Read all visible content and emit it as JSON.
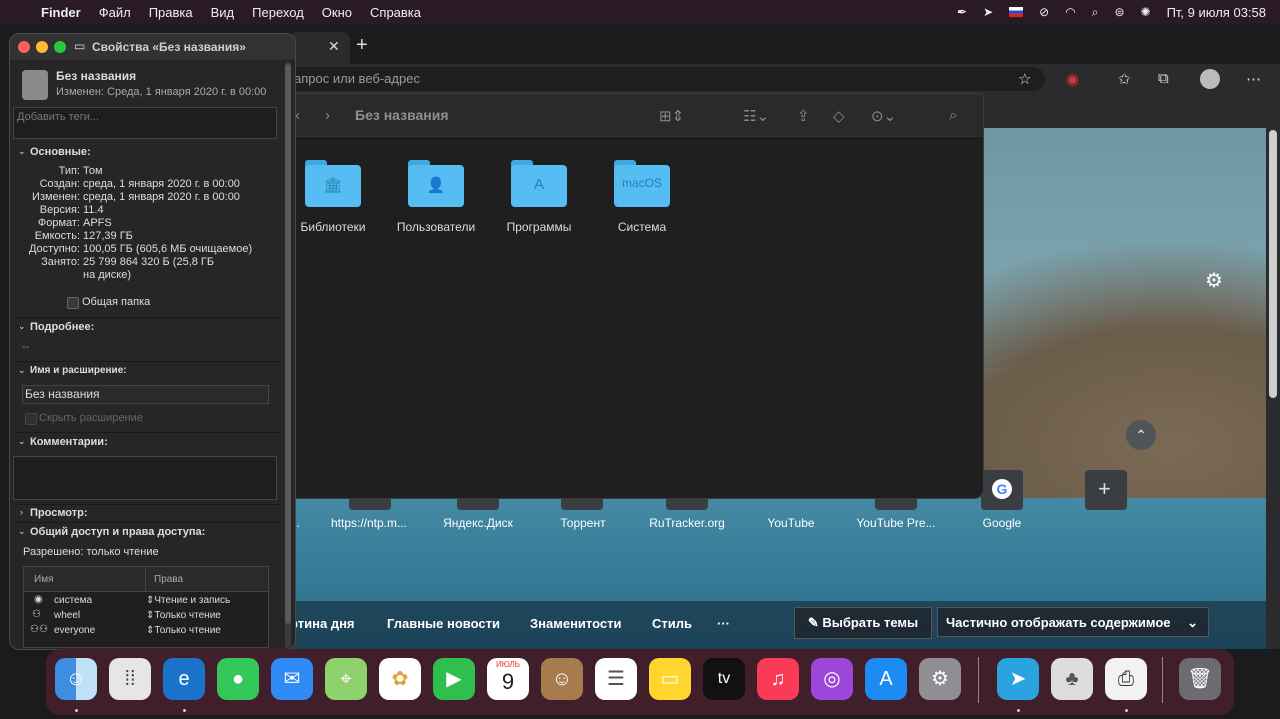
{
  "menubar": {
    "apple": "",
    "items": [
      "Finder",
      "Файл",
      "Правка",
      "Вид",
      "Переход",
      "Окно",
      "Справка"
    ],
    "clock": "Пт, 9 июля  03:58"
  },
  "browser": {
    "address_placeholder": "апрос или веб-адрес",
    "tiles": [
      {
        "label": "..."
      },
      {
        "label": "https://ntp.m..."
      },
      {
        "label": "Яндекс.Диск"
      },
      {
        "label": "Торрент"
      },
      {
        "label": "RuTracker.org"
      },
      {
        "label": "YouTube"
      },
      {
        "label": "YouTube Pre..."
      },
      {
        "label": "Google"
      }
    ],
    "news": [
      "ртина дня",
      "Главные новости",
      "Знаменитости",
      "Стиль",
      "···"
    ],
    "themes_button": "✎ Выбрать темы",
    "content_select": "Частично отображать содержимое"
  },
  "finder": {
    "title": "Без названия",
    "folders": [
      {
        "label": "Библиотеки",
        "emblem": "🏛"
      },
      {
        "label": "Пользователи",
        "emblem": "👤"
      },
      {
        "label": "Программы",
        "emblem": "A"
      },
      {
        "label": "Система",
        "emblem": "macOS"
      }
    ]
  },
  "info": {
    "window_title": "Свойства «Без названия»",
    "name": "Без названия",
    "modified_line": "Изменен: Среда, 1 января 2020 г. в 00:00",
    "tags_placeholder": "Добавить теги...",
    "basic_header": "Основные:",
    "rows": [
      {
        "label": "Тип:",
        "value": "Том"
      },
      {
        "label": "Создан:",
        "value": "среда, 1 января 2020 г. в 00:00"
      },
      {
        "label": "Изменен:",
        "value": "среда, 1 января 2020 г. в 00:00"
      },
      {
        "label": "Версия:",
        "value": "11.4"
      },
      {
        "label": "Формат:",
        "value": "APFS"
      },
      {
        "label": "Емкость:",
        "value": "127,39 ГБ"
      },
      {
        "label": "Доступно:",
        "value": "100,05 ГБ (605,6 МБ очищаемое)"
      },
      {
        "label": "Занято:",
        "value": "25 799 864 320 Б (25,8 ГБ"
      }
    ],
    "used_cont": "на диске)",
    "shared_folder": "Общая папка",
    "more_header": "Подробнее:",
    "more_value": "--",
    "name_ext_header": "Имя и расширение:",
    "name_field": "Без названия",
    "hide_ext": "Скрыть расширение",
    "comments_header": "Комментарии:",
    "preview_header": "Просмотр:",
    "sharing_header": "Общий доступ и права доступа:",
    "allowed": "Разрешено: только чтение",
    "perm_col_name": "Имя",
    "perm_col_rights": "Права",
    "perms": [
      {
        "name": "система",
        "right": "Чтение и запись"
      },
      {
        "name": "wheel",
        "right": "Только чтение"
      },
      {
        "name": "everyone",
        "right": "Только чтение"
      }
    ]
  },
  "dock": {
    "calendar_month": "ИЮЛЬ",
    "calendar_day": "9",
    "tv_label": "tv",
    "icons": [
      "finder-icon",
      "launchpad-icon",
      "edge-icon",
      "messages-icon",
      "mail-icon",
      "maps-icon",
      "photos-icon",
      "facetime-icon",
      "calendar-icon",
      "contacts-icon",
      "reminders-icon",
      "notes-icon",
      "appletv-icon",
      "music-icon",
      "podcasts-icon",
      "appstore-icon",
      "settings-icon",
      "telegram-icon",
      "tree-app-icon",
      "printer-icon",
      "trash-icon"
    ]
  },
  "colors": {
    "menubar": "#2a1a24",
    "folder": "#55bdf1",
    "dock": "#46202d"
  }
}
